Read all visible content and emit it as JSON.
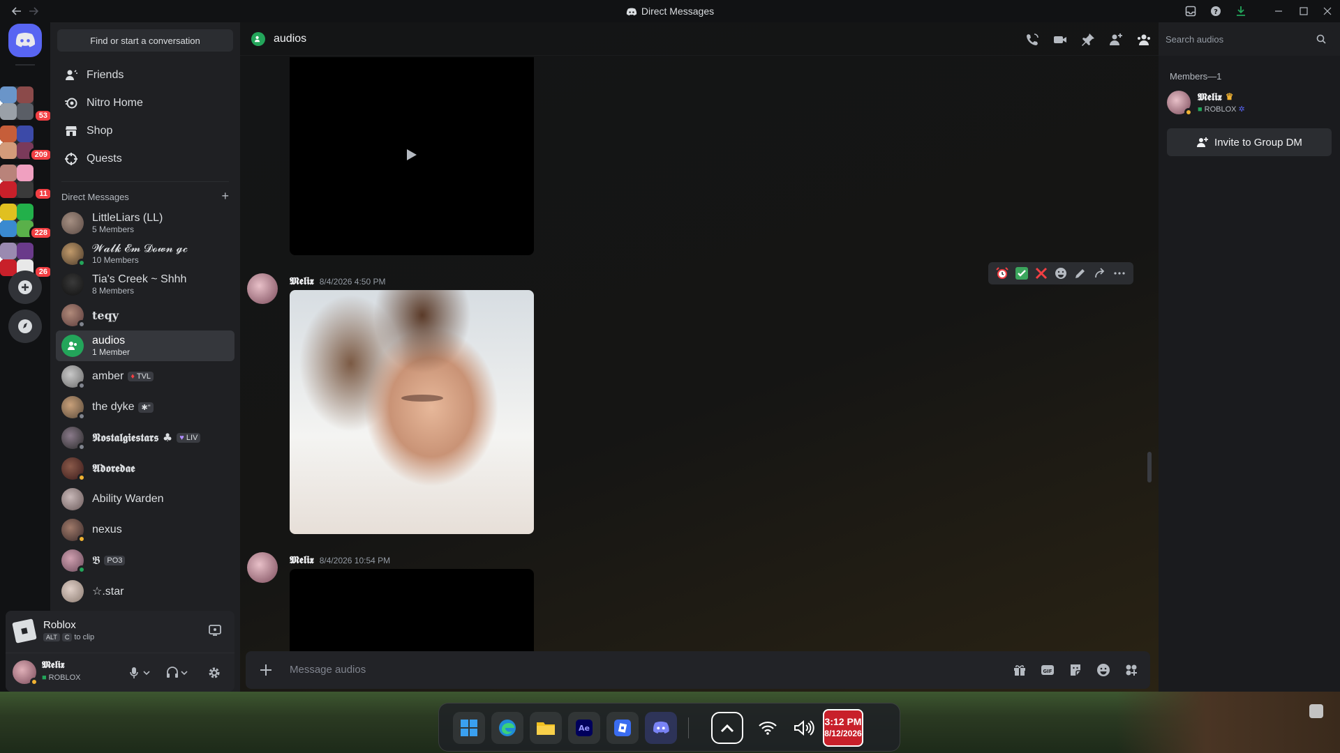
{
  "window": {
    "title": "Direct Messages"
  },
  "colors": {
    "accent": "#5865f2",
    "online": "#23a55a",
    "idle": "#f0b232",
    "danger": "#f23f43"
  },
  "servers": [
    {
      "badge": "53"
    },
    {
      "badge": "209"
    },
    {
      "badge": "11"
    },
    {
      "badge": "228"
    },
    {
      "badge": "26"
    }
  ],
  "sidebar": {
    "search_label": "Find or start a conversation",
    "nav": [
      {
        "label": "Friends",
        "icon": "friends-icon"
      },
      {
        "label": "Nitro Home",
        "icon": "nitro-icon"
      },
      {
        "label": "Shop",
        "icon": "shop-icon"
      },
      {
        "label": "Quests",
        "icon": "quests-icon"
      }
    ],
    "dm_header": "Direct Messages",
    "dms": [
      {
        "name": "LittleLiars (LL)",
        "sub": "5 Members"
      },
      {
        "name": "𝓦𝓪𝓵𝓴 𝓔𝓶 𝓓𝓸𝔀𝓷 𝓰𝓬",
        "sub": "10 Members"
      },
      {
        "name": "Tia's Creek ~ Shhh",
        "sub": "8 Members"
      },
      {
        "name": "teqy",
        "sub": ""
      },
      {
        "name": "audios",
        "sub": "1 Member"
      },
      {
        "name": "amber",
        "sub": "",
        "tag": "TVL"
      },
      {
        "name": "the dyke",
        "sub": "",
        "tag": "✱\""
      },
      {
        "name": "𝕹𝖔𝖘𝖙𝖆𝖑𝖌𝖎𝖊𝖘𝖙𝖆𝖗𝖘 ♣",
        "sub": "",
        "tag": "LIV"
      },
      {
        "name": "𝕬𝖉𝖔𝖗𝖊𝖉𝖆𝖊",
        "sub": ""
      },
      {
        "name": "Ability Warden",
        "sub": ""
      },
      {
        "name": "nexus",
        "sub": ""
      },
      {
        "name": "𝕭",
        "sub": "",
        "tag": "PO3"
      },
      {
        "name": "☆.star",
        "sub": ""
      }
    ]
  },
  "activity": {
    "game": "Roblox",
    "key1": "ALT",
    "key2": "C",
    "hint": "to clip"
  },
  "user": {
    "name": "𝕸𝖊𝖑𝖎𝖝",
    "status": "ROBLOX"
  },
  "channel": {
    "name": "audios",
    "search_placeholder": "Search audios",
    "composer_placeholder": "Message audios"
  },
  "messages": [
    {
      "author": "𝕸𝖊𝖑𝖎𝖝",
      "time": "8/4/2026 4:50 PM"
    },
    {
      "author": "𝕸𝖊𝖑𝖎𝖝",
      "time": "8/4/2026 10:54 PM"
    }
  ],
  "members": {
    "header": "Members—1",
    "list": [
      {
        "name": "𝕸𝖊𝖑𝖎𝖝",
        "status": "ROBLOX"
      }
    ],
    "invite_label": "Invite to Group DM"
  },
  "taskbar": {
    "time": "3:12 PM",
    "date": "8/12/2026"
  }
}
